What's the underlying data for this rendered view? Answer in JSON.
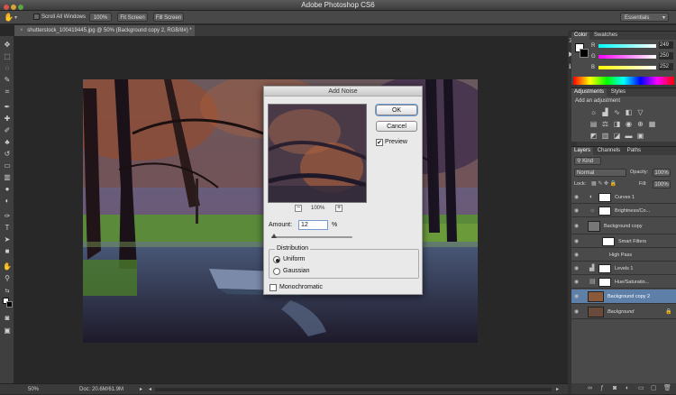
{
  "app": {
    "title": "Adobe Photoshop CS6"
  },
  "options_bar": {
    "scroll_all_label": "Scroll All Windows",
    "zoom_label": "100%",
    "fit_label": "Fit Screen",
    "fill_label": "Fill Screen",
    "workspace": "Essentials"
  },
  "document": {
    "tab_title": "shutterstock_100419445.jpg @ 50% (Background copy 2, RGB/8#) *"
  },
  "status": {
    "zoom": "50%",
    "doc": "Doc: 20.6M/61.9M"
  },
  "dialog": {
    "title": "Add Noise",
    "ok": "OK",
    "cancel": "Cancel",
    "preview_label": "Preview",
    "preview_zoom": "100%",
    "amount_label": "Amount:",
    "amount_value": "12",
    "amount_unit": "%",
    "amount_slider_fraction": 0.03,
    "distribution_title": "Distribution",
    "uniform": "Uniform",
    "gaussian": "Gaussian",
    "monochromatic": "Monochromatic"
  },
  "color_panel": {
    "tabs": [
      "Color",
      "Swatches"
    ],
    "r": "249",
    "g": "250",
    "b": "252",
    "r_label": "R",
    "g_label": "G",
    "b_label": "B"
  },
  "adjustments_panel": {
    "tabs": [
      "Adjustments",
      "Styles"
    ],
    "hint": "Add an adjustment"
  },
  "layers_panel": {
    "tabs": [
      "Layers",
      "Channels",
      "Paths"
    ],
    "kind": "Kind",
    "blend_mode": "Normal",
    "opacity_label": "Opacity:",
    "opacity_value": "100%",
    "lock_label": "Lock:",
    "fill_label": "Fill:",
    "fill_value": "100%",
    "layers": [
      {
        "name": "Curves 1"
      },
      {
        "name": "Brightness/Co..."
      },
      {
        "name": "Background copy"
      },
      {
        "name": "Smart Filters"
      },
      {
        "name": "High Pass"
      },
      {
        "name": "Levels 1"
      },
      {
        "name": "Hue/Saturatio..."
      },
      {
        "name": "Background copy 2"
      },
      {
        "name": "Background"
      }
    ]
  }
}
